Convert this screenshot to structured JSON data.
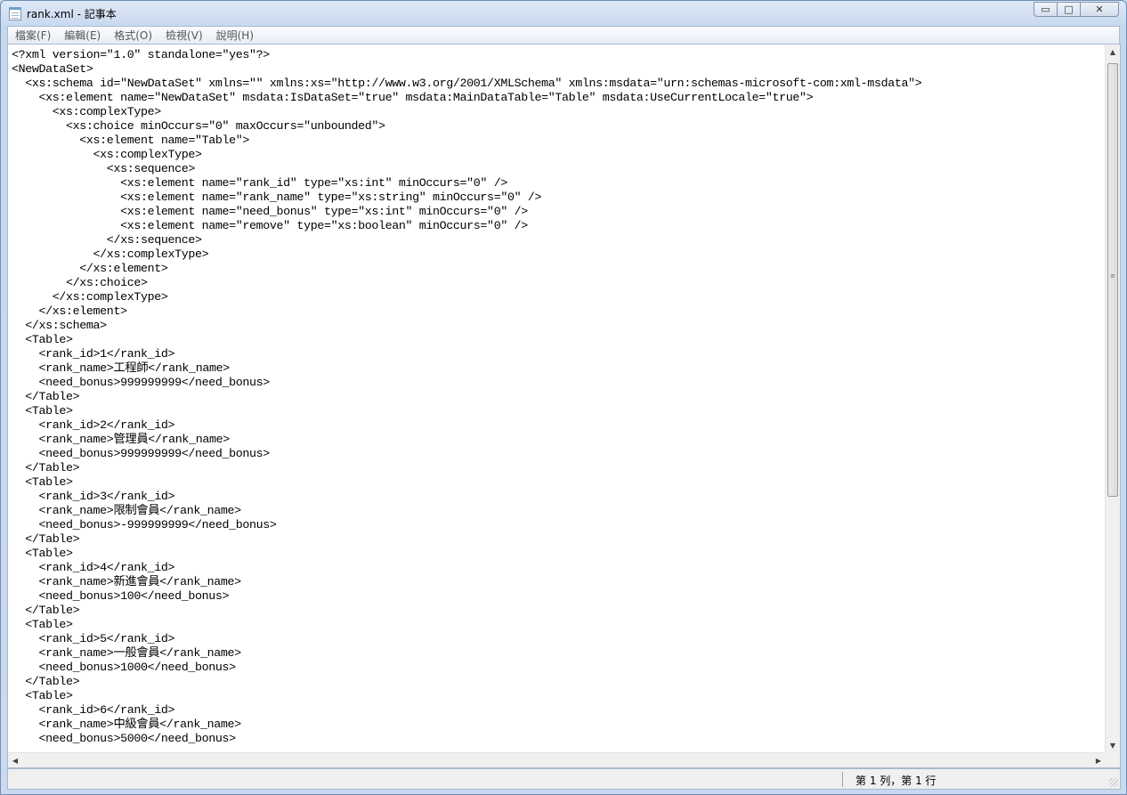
{
  "window": {
    "title": "rank.xml - 記事本",
    "minimize_glyph": "▭",
    "maximize_glyph": "□",
    "close_glyph": "✕"
  },
  "menu": [
    "檔案(F)",
    "編輯(E)",
    "格式(O)",
    "檢視(V)",
    "說明(H)"
  ],
  "editor": {
    "lines": [
      "<?xml version=\"1.0\" standalone=\"yes\"?>",
      "<NewDataSet>",
      "  <xs:schema id=\"NewDataSet\" xmlns=\"\" xmlns:xs=\"http://www.w3.org/2001/XMLSchema\" xmlns:msdata=\"urn:schemas-microsoft-com:xml-msdata\">",
      "    <xs:element name=\"NewDataSet\" msdata:IsDataSet=\"true\" msdata:MainDataTable=\"Table\" msdata:UseCurrentLocale=\"true\">",
      "      <xs:complexType>",
      "        <xs:choice minOccurs=\"0\" maxOccurs=\"unbounded\">",
      "          <xs:element name=\"Table\">",
      "            <xs:complexType>",
      "              <xs:sequence>",
      "                <xs:element name=\"rank_id\" type=\"xs:int\" minOccurs=\"0\" />",
      "                <xs:element name=\"rank_name\" type=\"xs:string\" minOccurs=\"0\" />",
      "                <xs:element name=\"need_bonus\" type=\"xs:int\" minOccurs=\"0\" />",
      "                <xs:element name=\"remove\" type=\"xs:boolean\" minOccurs=\"0\" />",
      "              </xs:sequence>",
      "            </xs:complexType>",
      "          </xs:element>",
      "        </xs:choice>",
      "      </xs:complexType>",
      "    </xs:element>",
      "  </xs:schema>",
      "  <Table>",
      "    <rank_id>1</rank_id>",
      "    <rank_name>工程師</rank_name>",
      "    <need_bonus>999999999</need_bonus>",
      "  </Table>",
      "  <Table>",
      "    <rank_id>2</rank_id>",
      "    <rank_name>管理員</rank_name>",
      "    <need_bonus>999999999</need_bonus>",
      "  </Table>",
      "  <Table>",
      "    <rank_id>3</rank_id>",
      "    <rank_name>限制會員</rank_name>",
      "    <need_bonus>-999999999</need_bonus>",
      "  </Table>",
      "  <Table>",
      "    <rank_id>4</rank_id>",
      "    <rank_name>新進會員</rank_name>",
      "    <need_bonus>100</need_bonus>",
      "  </Table>",
      "  <Table>",
      "    <rank_id>5</rank_id>",
      "    <rank_name>一般會員</rank_name>",
      "    <need_bonus>1000</need_bonus>",
      "  </Table>",
      "  <Table>",
      "    <rank_id>6</rank_id>",
      "    <rank_name>中級會員</rank_name>",
      "    <need_bonus>5000</need_bonus>"
    ]
  },
  "status": {
    "position": "第 1 列，第 1 行"
  }
}
